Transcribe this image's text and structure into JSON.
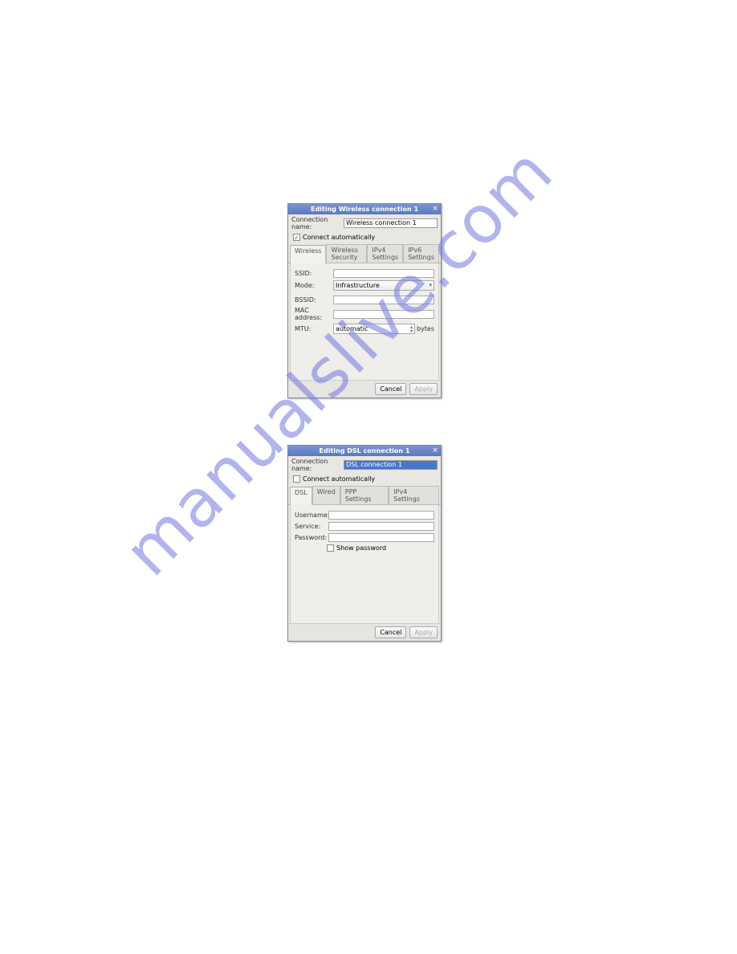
{
  "watermark": "manualslive.com",
  "dialog1": {
    "title": "Editing Wireless connection 1",
    "conn_label": "Connection name:",
    "conn_value": "Wireless connection 1",
    "auto_label": "Connect automatically",
    "auto_checked": true,
    "tabs": [
      "Wireless",
      "Wireless Security",
      "IPv4 Settings",
      "IPv6 Settings"
    ],
    "fields": {
      "ssid_label": "SSID:",
      "ssid_value": "",
      "mode_label": "Mode:",
      "mode_value": "Infrastructure",
      "bssid_label": "BSSID:",
      "bssid_value": "",
      "mac_label": "MAC address:",
      "mac_value": "",
      "mtu_label": "MTU:",
      "mtu_value": "automatic",
      "mtu_unit": "bytes"
    },
    "buttons": {
      "cancel": "Cancel",
      "apply": "Apply"
    }
  },
  "dialog2": {
    "title": "Editing DSL connection 1",
    "conn_label": "Connection name:",
    "conn_value": "DSL connection 1",
    "auto_label": "Connect automatically",
    "auto_checked": false,
    "tabs": [
      "DSL",
      "Wired",
      "PPP Settings",
      "IPv4 Settings"
    ],
    "fields": {
      "user_label": "Username:",
      "user_value": "",
      "service_label": "Service:",
      "service_value": "",
      "pass_label": "Password:",
      "pass_value": "",
      "showpw_label": "Show password"
    },
    "buttons": {
      "cancel": "Cancel",
      "apply": "Apply"
    }
  }
}
